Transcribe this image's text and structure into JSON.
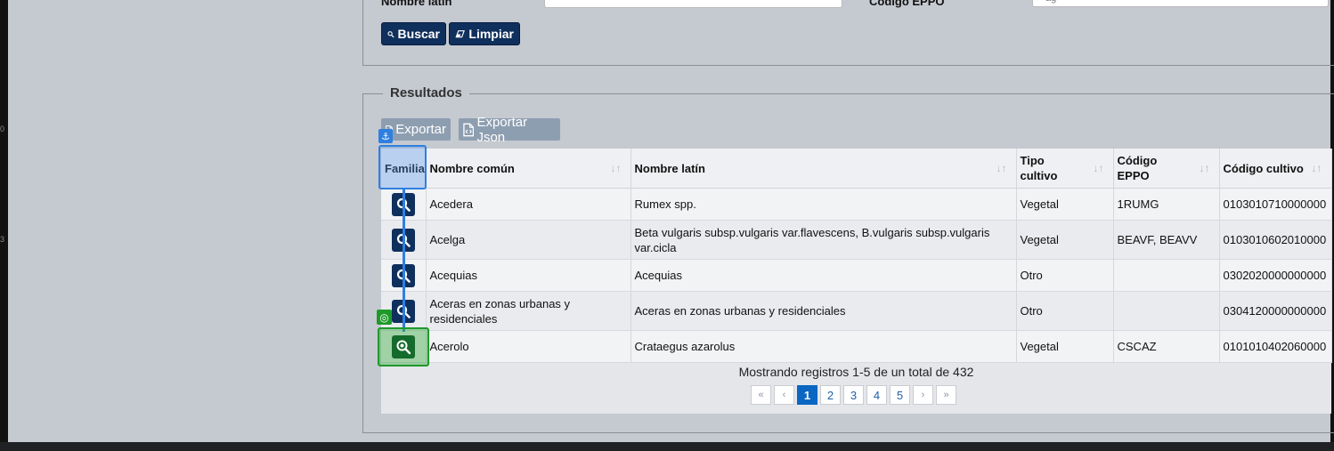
{
  "search_form": {
    "latin_name_label": "Nombre latín",
    "eppo_code_label": "Código EPPO",
    "eppo_code_value": "ag",
    "search_button": "Buscar",
    "clear_button": "Limpiar"
  },
  "results": {
    "legend": "Resultados",
    "export_button": "Exportar",
    "export_json_button": "Exportar Json",
    "columns": {
      "family": "Familia",
      "common_name": "Nombre común",
      "latin_name": "Nombre latín",
      "crop_type_line1": "Tipo",
      "crop_type_line2": "cultivo",
      "eppo_line1": "Código",
      "eppo_line2": "EPPO",
      "crop_code": "Código cultivo"
    },
    "rows": [
      {
        "common": "Acedera",
        "latin": "Rumex spp.",
        "type": "Vegetal",
        "eppo": "1RUMG",
        "code": "0103010710000000"
      },
      {
        "common": "Acelga",
        "latin": "Beta vulgaris subsp.vulgaris var.flavescens, B.vulgaris subsp.vulgaris var.cicla",
        "type": "Vegetal",
        "eppo": "BEAVF, BEAVV",
        "code": "0103010602010000"
      },
      {
        "common": "Acequias",
        "latin": "Acequias",
        "type": "Otro",
        "eppo": "",
        "code": "0302020000000000"
      },
      {
        "common": "Aceras en zonas urbanas y residenciales",
        "latin": "Aceras en zonas urbanas y residenciales",
        "type": "Otro",
        "eppo": "",
        "code": "0304120000000000"
      },
      {
        "common": "Acerolo",
        "latin": "Crataegus azarolus",
        "type": "Vegetal",
        "eppo": "CSCAZ",
        "code": "0101010402060000"
      }
    ],
    "footer_text": "Mostrando registros 1-5 de un total de 432",
    "pagination": {
      "first": "«",
      "prev": "‹",
      "pages": [
        "1",
        "2",
        "3",
        "4",
        "5"
      ],
      "next": "›",
      "last": "»"
    }
  },
  "side_marks": {
    "mark_a": "0",
    "mark_b": "3"
  },
  "colors": {
    "primary_button": "#0f2f5c",
    "export_button": "#8e9eb1",
    "active_page": "#0a66c2",
    "anchor_highlight": "#2f7fe0",
    "target_highlight": "#1e9a2a"
  },
  "icons": [
    "search-icon",
    "eraser-icon",
    "file-export-icon",
    "file-json-icon",
    "sort-icon",
    "anchor-icon",
    "target-icon"
  ]
}
